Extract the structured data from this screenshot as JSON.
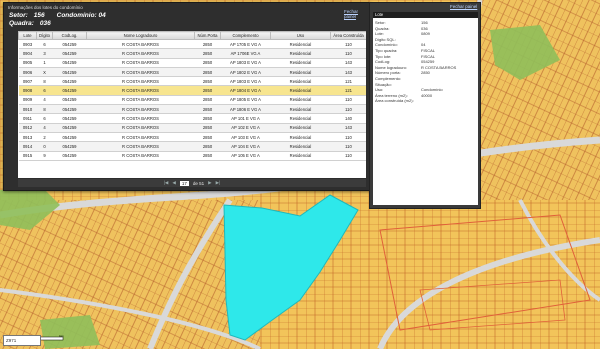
{
  "window": {
    "title": "Informações dos lotes do condomínio",
    "close_label": "Fechar painel"
  },
  "header": {
    "setor_label": "Setor:",
    "setor_value": "156",
    "condominio_label": "Condomínio: 04",
    "quadra_label": "Quadra:",
    "quadra_value": "036"
  },
  "table": {
    "columns": [
      "Lote",
      "Dígito",
      "CodLog.",
      "Nome Logradouro",
      "Núm.Porta",
      "Complemento",
      "Uso",
      "Área Construída"
    ],
    "rows": [
      [
        "0903",
        "6",
        "054259",
        "R COSTA BARROS",
        "2850",
        "AP 1705 E VG A",
        "Residencial",
        "110"
      ],
      [
        "0904",
        "3",
        "054259",
        "R COSTA BARROS",
        "2850",
        "AP 1706E VG A",
        "Residencial",
        "110"
      ],
      [
        "0905",
        "1",
        "054259",
        "R COSTA BARROS",
        "2850",
        "AP 1803 E VG A",
        "Residencial",
        "143"
      ],
      [
        "0906",
        "X",
        "054259",
        "R COSTA BARROS",
        "2850",
        "AP 1802 E VG A",
        "Residencial",
        "143"
      ],
      [
        "0907",
        "8",
        "054259",
        "R COSTA BARROS",
        "2850",
        "AP 1803 E VG A",
        "Residencial",
        "121"
      ],
      [
        "0908",
        "6",
        "054259",
        "R COSTA BARROS",
        "2850",
        "AP 1804 E VG A",
        "Residencial",
        "121"
      ],
      [
        "0909",
        "4",
        "054259",
        "R COSTA BARROS",
        "2850",
        "AP 1805 E VG A",
        "Residencial",
        "110"
      ],
      [
        "0910",
        "8",
        "054259",
        "R COSTA BARROS",
        "2850",
        "AP 1806 E VG A",
        "Residencial",
        "110"
      ],
      [
        "0911",
        "6",
        "054259",
        "R COSTA BARROS",
        "2850",
        "AP 101 E VG A",
        "Residencial",
        "140"
      ],
      [
        "0912",
        "4",
        "054259",
        "R COSTA BARROS",
        "2850",
        "AP 102 E VG A",
        "Residencial",
        "143"
      ],
      [
        "0913",
        "2",
        "054259",
        "R COSTA BARROS",
        "2850",
        "AP 103 E VG A",
        "Residencial",
        "110"
      ],
      [
        "0914",
        "0",
        "054259",
        "R COSTA BARROS",
        "2850",
        "AP 104 E VG A",
        "Residencial",
        "110"
      ],
      [
        "0915",
        "9",
        "054259",
        "R COSTA BARROS",
        "2850",
        "AP 105 E VG A",
        "Residencial",
        "110"
      ]
    ]
  },
  "pager": {
    "first": "|◀",
    "prev": "◀",
    "page": "17",
    "of_label": "de 51",
    "next": "▶",
    "last": "▶|"
  },
  "info_panel": {
    "close_label": "Fechar painel",
    "header": "Lote",
    "rows": [
      [
        "Setor:",
        "156"
      ],
      [
        "Quadra:",
        "036"
      ],
      [
        "Lote:",
        "0809"
      ],
      [
        "Dígito SQL:",
        ""
      ],
      [
        "Condomínio:",
        "04"
      ],
      [
        "Tipo quadra:",
        "FISCAL"
      ],
      [
        "Tipo lote:",
        "FISCAL"
      ],
      [
        "CodLog:",
        "054259"
      ],
      [
        "Nome logradouro:",
        "R COSTA BARROS"
      ],
      [
        "Número porta:",
        "2850"
      ],
      [
        "Complemento:",
        ""
      ],
      [
        "Situação:",
        ""
      ],
      [
        "Uso:",
        "Condomínio"
      ],
      [
        "Área terreno (m2):",
        "40000"
      ],
      [
        "Área construída (m2):",
        ""
      ]
    ]
  },
  "scale": {
    "labels": [
      "0",
      "500m",
      "1km"
    ]
  },
  "coord": {
    "value": "Z971"
  },
  "colors": {
    "lot_fill": "#f2c45a",
    "lot_stroke": "#c46a2a",
    "highlight": "#2ee8ea",
    "road": "#cfcfcf",
    "green": "#8fbf5a",
    "selected_row": "#f7e58f"
  }
}
